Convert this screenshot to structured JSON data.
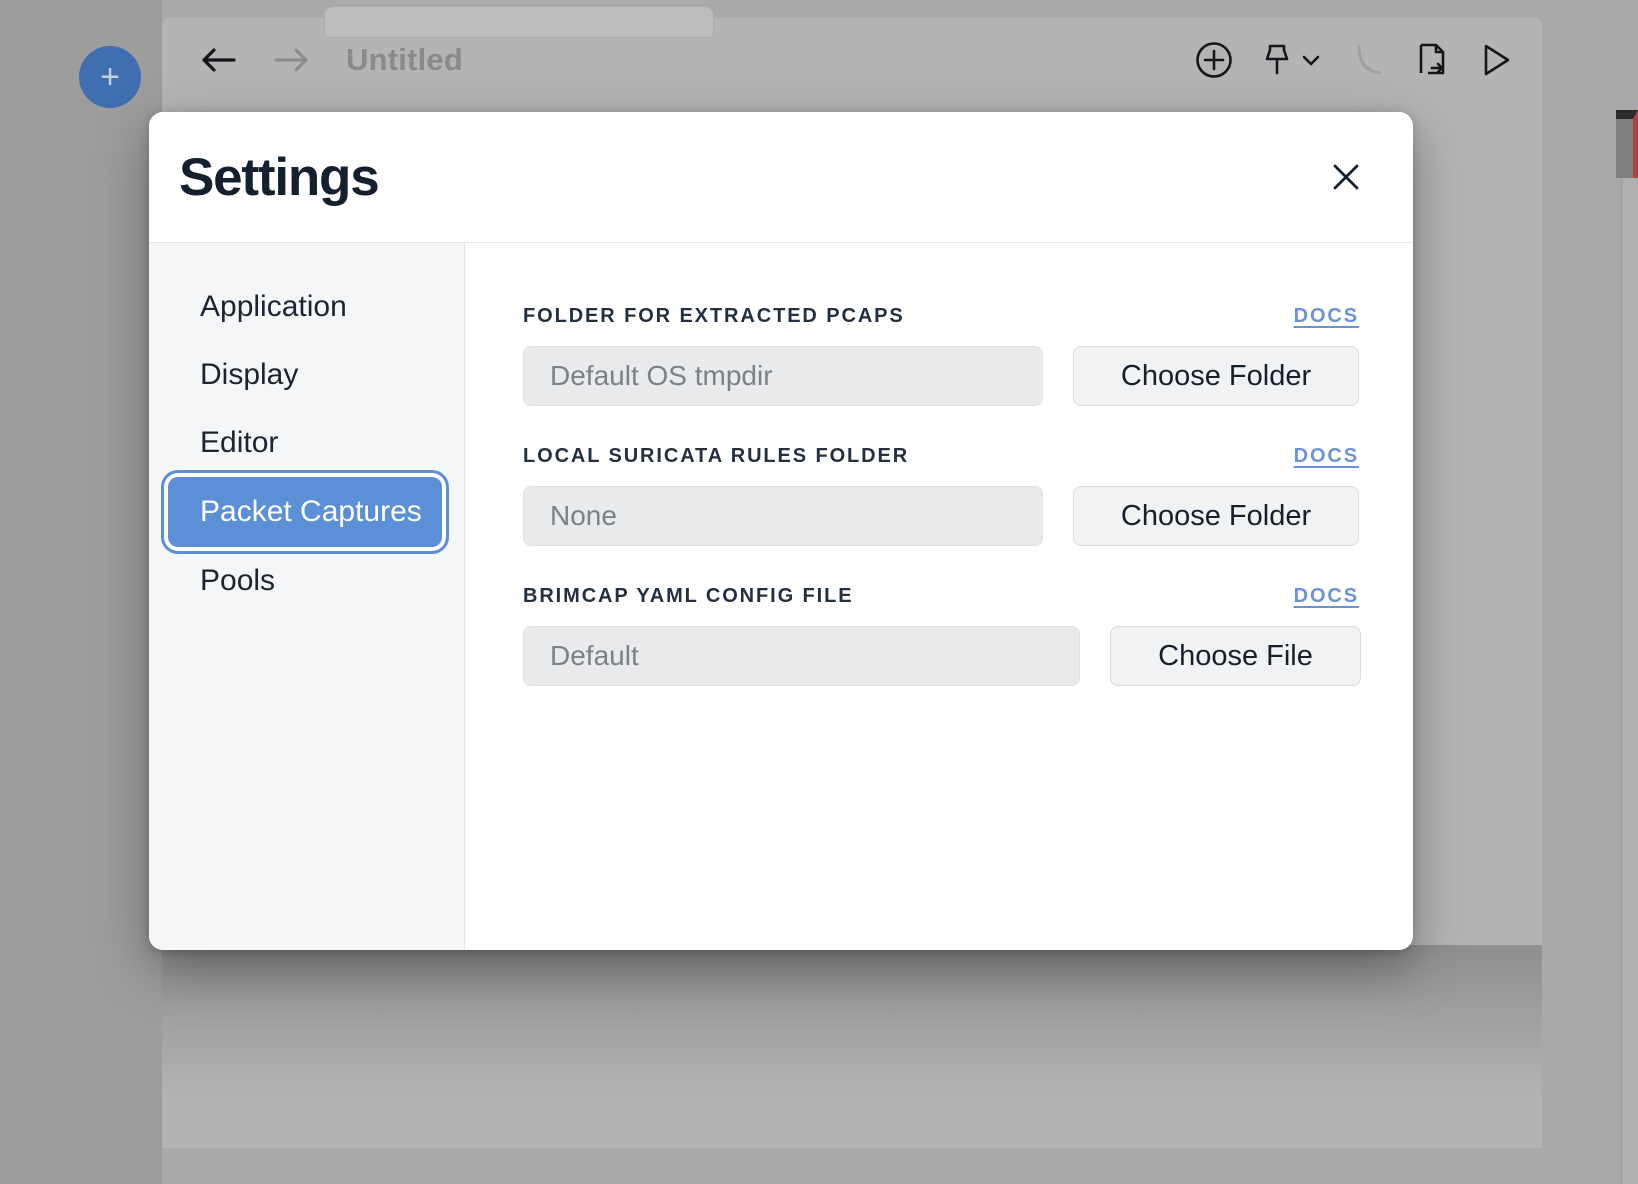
{
  "background": {
    "new_tab_button_label": "+",
    "nav_back_icon": "arrow-left-icon",
    "nav_forward_icon": "arrow-right-icon",
    "window_title": "Untitled",
    "toolbar_icons": [
      {
        "name": "plus-circle-icon",
        "enabled": true
      },
      {
        "name": "pin-icon",
        "enabled": true
      },
      {
        "name": "chevron-down-icon",
        "enabled": true
      },
      {
        "name": "wireshark-fin-icon",
        "enabled": false
      },
      {
        "name": "file-export-icon",
        "enabled": true
      },
      {
        "name": "run-play-icon",
        "enabled": true
      }
    ]
  },
  "dialog": {
    "title": "Settings",
    "close_icon": "close-icon"
  },
  "sidebar": {
    "items": [
      {
        "label": "Application",
        "selected": false
      },
      {
        "label": "Display",
        "selected": false
      },
      {
        "label": "Editor",
        "selected": false
      },
      {
        "label": "Packet Captures",
        "selected": true
      },
      {
        "label": "Pools",
        "selected": false
      }
    ]
  },
  "settings": {
    "docs_label": "DOCS",
    "groups": [
      {
        "label": "Folder for extracted PCAPs",
        "value": "",
        "placeholder": "Default OS tmpdir",
        "button_label": "Choose Folder",
        "docs_label": "DOCS"
      },
      {
        "label": "Local Suricata rules folder",
        "value": "",
        "placeholder": "None",
        "button_label": "Choose Folder",
        "docs_label": "DOCS"
      },
      {
        "label": "Brimcap YAML config file",
        "value": "",
        "placeholder": "Default",
        "button_label": "Choose File",
        "docs_label": "DOCS"
      }
    ]
  },
  "colors": {
    "accent_blue": "#5b8fd6",
    "link_blue": "#6b93db",
    "new_tab_blue": "#3f6fb0",
    "title_navy": "#14202f",
    "input_gray": "#e9eaec",
    "sidebar_gray": "#f5f6f7"
  }
}
